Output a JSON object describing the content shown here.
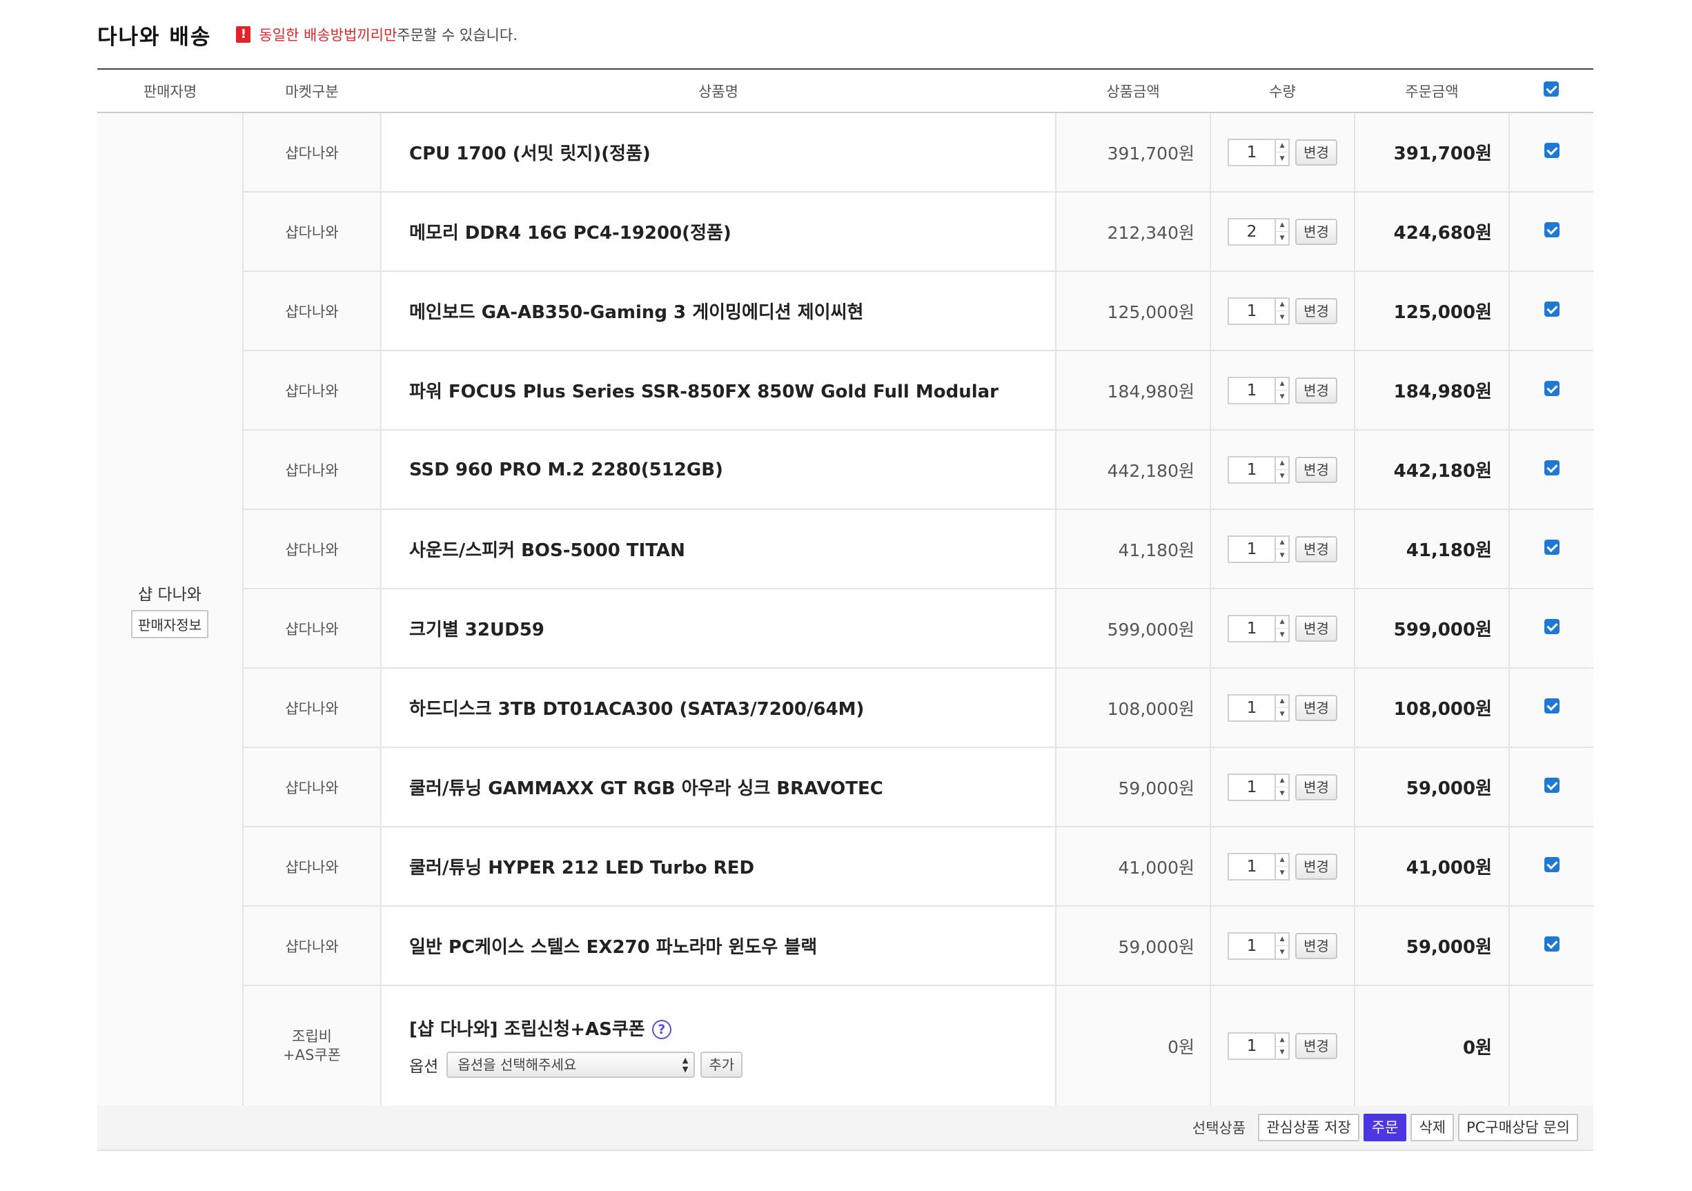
{
  "section": {
    "title": "다나와 배송",
    "notice_highlight": "동일한 배송방법끼리만",
    "notice_rest": " 주문할 수 있습니다."
  },
  "columns": {
    "seller": "판매자명",
    "market": "마켓구분",
    "product": "상품명",
    "price": "상품금액",
    "qty": "수량",
    "total": "주문금액"
  },
  "seller": {
    "name": "샵 다나와",
    "info_button": "판매자정보"
  },
  "change_label": "변경",
  "items": [
    {
      "market": "샵다나와",
      "name": "CPU 1700 (서밋 릿지)(정품)",
      "price": "391,700원",
      "qty": "1",
      "total": "391,700원"
    },
    {
      "market": "샵다나와",
      "name": "메모리 DDR4 16G PC4-19200(정품)",
      "price": "212,340원",
      "qty": "2",
      "total": "424,680원"
    },
    {
      "market": "샵다나와",
      "name": "메인보드 GA-AB350-Gaming 3 게이밍에디션 제이씨현",
      "price": "125,000원",
      "qty": "1",
      "total": "125,000원"
    },
    {
      "market": "샵다나와",
      "name": "파워 FOCUS Plus Series SSR-850FX 850W Gold Full Modular",
      "price": "184,980원",
      "qty": "1",
      "total": "184,980원"
    },
    {
      "market": "샵다나와",
      "name": "SSD 960 PRO M.2 2280(512GB)",
      "price": "442,180원",
      "qty": "1",
      "total": "442,180원"
    },
    {
      "market": "샵다나와",
      "name": "사운드/스피커 BOS-5000 TITAN",
      "price": "41,180원",
      "qty": "1",
      "total": "41,180원"
    },
    {
      "market": "샵다나와",
      "name": "크기별 32UD59",
      "price": "599,000원",
      "qty": "1",
      "total": "599,000원"
    },
    {
      "market": "샵다나와",
      "name": "하드디스크 3TB DT01ACA300 (SATA3/7200/64M)",
      "price": "108,000원",
      "qty": "1",
      "total": "108,000원"
    },
    {
      "market": "샵다나와",
      "name": "쿨러/튜닝 GAMMAXX GT RGB 아우라 싱크 BRAVOTEC",
      "price": "59,000원",
      "qty": "1",
      "total": "59,000원"
    },
    {
      "market": "샵다나와",
      "name": "쿨러/튜닝 HYPER 212 LED Turbo RED",
      "price": "41,000원",
      "qty": "1",
      "total": "41,000원"
    },
    {
      "market": "샵다나와",
      "name": "일반 PC케이스 스텔스 EX270 파노라마 윈도우 블랙",
      "price": "59,000원",
      "qty": "1",
      "total": "59,000원"
    }
  ],
  "assembly": {
    "market_line1": "조립비",
    "market_line2": "+AS쿠폰",
    "name": "[샵 다나와] 조립신청+AS쿠폰",
    "help_glyph": "?",
    "option_label": "옵션",
    "option_select": "옵션을 선택해주세요",
    "add_button": "추가",
    "price": "0원",
    "qty": "1",
    "total": "0원"
  },
  "footer": {
    "label": "선택상품",
    "wishlist": "관심상품 저장",
    "order": "주문",
    "delete": "삭제",
    "consult": "PC구매상담 문의"
  },
  "colors": {
    "accent": "#4a37e2",
    "warning": "#e0262b",
    "checkbox": "#1f78d1"
  }
}
